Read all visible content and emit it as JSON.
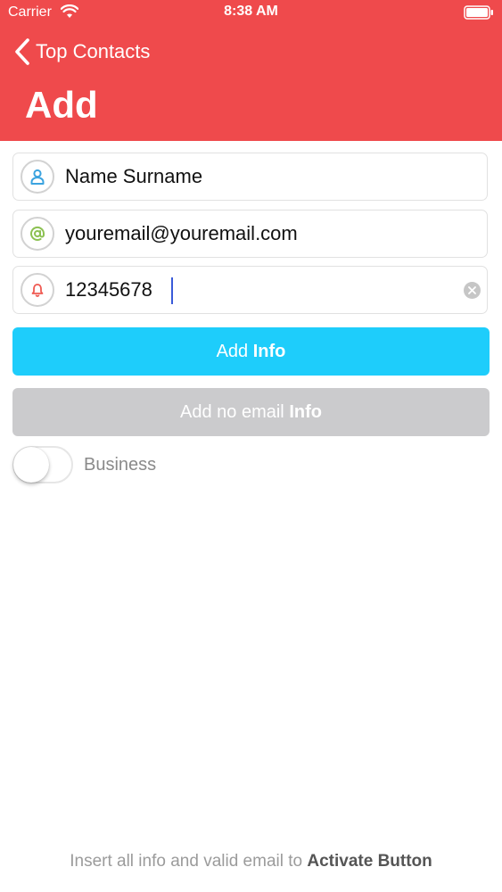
{
  "status_bar": {
    "carrier": "Carrier",
    "time": "8:38 AM",
    "wifi_icon": "wifi-icon",
    "battery_icon": "battery-icon"
  },
  "nav": {
    "back_label": "Top Contacts",
    "back_icon": "chevron-left-icon",
    "title": "Add"
  },
  "form": {
    "name": {
      "value": "Name Surname",
      "icon": "person-icon",
      "icon_color": "#3ba3df"
    },
    "email": {
      "value": "youremail@youremail.com",
      "icon": "at-sign-icon",
      "icon_color": "#8cc152"
    },
    "phone": {
      "value": "12345678",
      "icon": "bell-icon",
      "icon_color": "#ef5a52"
    }
  },
  "buttons": {
    "add_info": {
      "prefix": "Add",
      "bold": "Info",
      "color": "#1ecdfb"
    },
    "add_no_email_info": {
      "prefix": "Add no email",
      "bold": "Info",
      "color": "#cbcbcd"
    }
  },
  "toggle": {
    "label": "Business",
    "on": false
  },
  "footer": {
    "prefix": "Insert all info and valid email to",
    "bold": "Activate Button"
  },
  "colors": {
    "header": "#ef4a4c",
    "text_muted": "#9b9b9b"
  }
}
